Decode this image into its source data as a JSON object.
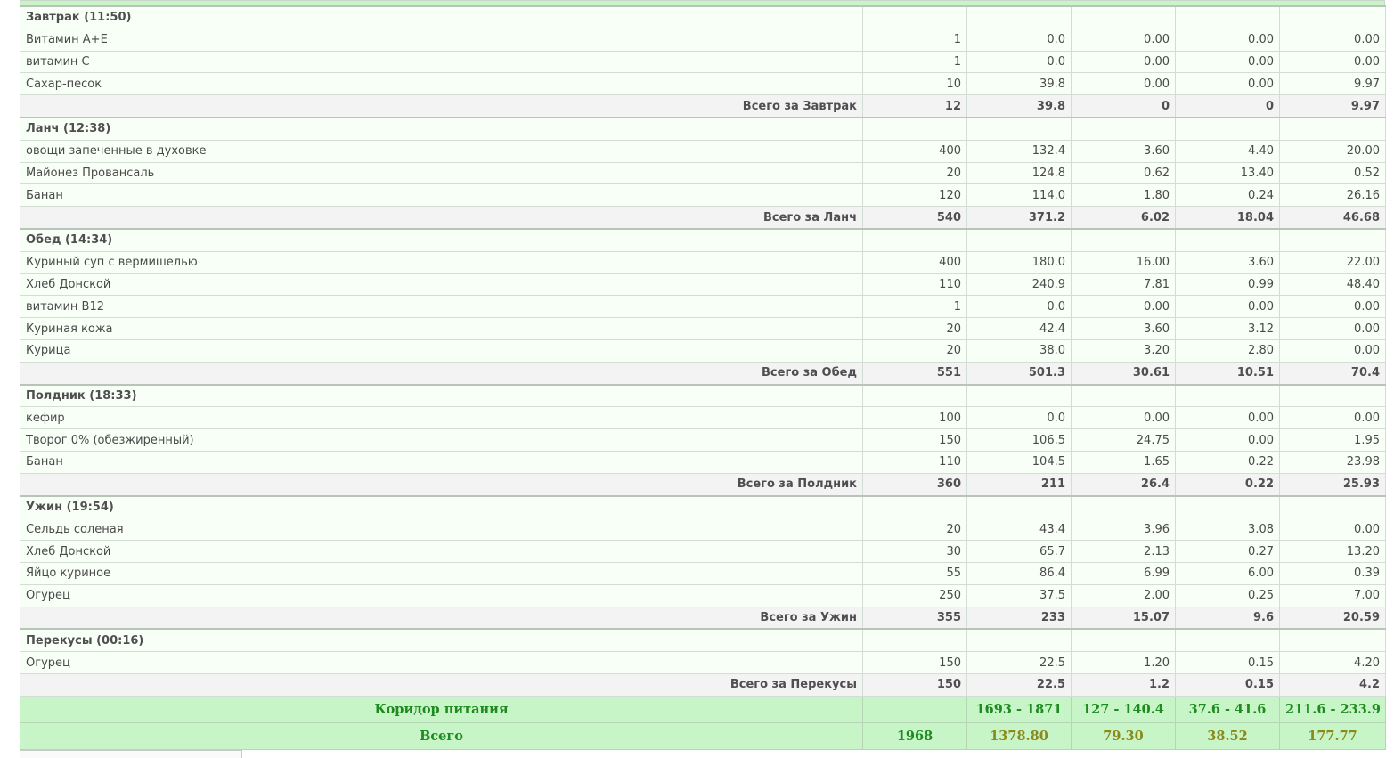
{
  "meals": [
    {
      "title": "Завтрак (11:50)",
      "items": [
        [
          "Витамин А+Е",
          "1",
          "0.0",
          "0.00",
          "0.00",
          "0.00"
        ],
        [
          "витамин С",
          "1",
          "0.0",
          "0.00",
          "0.00",
          "0.00"
        ],
        [
          "Сахар-песок",
          "10",
          "39.8",
          "0.00",
          "0.00",
          "9.97"
        ]
      ],
      "subtotal": [
        "Всего за Завтрак",
        "12",
        "39.8",
        "0",
        "0",
        "9.97"
      ]
    },
    {
      "title": "Ланч (12:38)",
      "items": [
        [
          "овощи запеченные в духовке",
          "400",
          "132.4",
          "3.60",
          "4.40",
          "20.00"
        ],
        [
          "Майонез Провансаль",
          "20",
          "124.8",
          "0.62",
          "13.40",
          "0.52"
        ],
        [
          "Банан",
          "120",
          "114.0",
          "1.80",
          "0.24",
          "26.16"
        ]
      ],
      "subtotal": [
        "Всего за Ланч",
        "540",
        "371.2",
        "6.02",
        "18.04",
        "46.68"
      ]
    },
    {
      "title": "Обед (14:34)",
      "items": [
        [
          "Куриный суп с вермишелью",
          "400",
          "180.0",
          "16.00",
          "3.60",
          "22.00"
        ],
        [
          "Хлеб Донской",
          "110",
          "240.9",
          "7.81",
          "0.99",
          "48.40"
        ],
        [
          "витамин B12",
          "1",
          "0.0",
          "0.00",
          "0.00",
          "0.00"
        ],
        [
          "Куриная кожа",
          "20",
          "42.4",
          "3.60",
          "3.12",
          "0.00"
        ],
        [
          "Курица",
          "20",
          "38.0",
          "3.20",
          "2.80",
          "0.00"
        ]
      ],
      "subtotal": [
        "Всего за Обед",
        "551",
        "501.3",
        "30.61",
        "10.51",
        "70.4"
      ]
    },
    {
      "title": "Полдник (18:33)",
      "items": [
        [
          "кефир",
          "100",
          "0.0",
          "0.00",
          "0.00",
          "0.00"
        ],
        [
          "Творог 0% (обезжиренный)",
          "150",
          "106.5",
          "24.75",
          "0.00",
          "1.95"
        ],
        [
          "Банан",
          "110",
          "104.5",
          "1.65",
          "0.22",
          "23.98"
        ]
      ],
      "subtotal": [
        "Всего за Полдник",
        "360",
        "211",
        "26.4",
        "0.22",
        "25.93"
      ]
    },
    {
      "title": "Ужин (19:54)",
      "items": [
        [
          "Сельдь соленая",
          "20",
          "43.4",
          "3.96",
          "3.08",
          "0.00"
        ],
        [
          "Хлеб Донской",
          "30",
          "65.7",
          "2.13",
          "0.27",
          "13.20"
        ],
        [
          "Яйцо куриное",
          "55",
          "86.4",
          "6.99",
          "6.00",
          "0.39"
        ],
        [
          "Огурец",
          "250",
          "37.5",
          "2.00",
          "0.25",
          "7.00"
        ]
      ],
      "subtotal": [
        "Всего за Ужин",
        "355",
        "233",
        "15.07",
        "9.6",
        "20.59"
      ]
    },
    {
      "title": "Перекусы (00:16)",
      "items": [
        [
          "Огурец",
          "150",
          "22.5",
          "1.20",
          "0.15",
          "4.20"
        ]
      ],
      "subtotal": [
        "Всего за Перекусы",
        "150",
        "22.5",
        "1.2",
        "0.15",
        "4.2"
      ]
    }
  ],
  "corridor": {
    "label": "Коридор питания",
    "weight": "",
    "kcal": "1693 - 1871",
    "protein": "127 - 140.4",
    "fat": "37.6 - 41.6",
    "carbs": "211.6 - 233.9"
  },
  "grand_total": {
    "label": "Всего",
    "weight": "1968",
    "kcal": "1378.80",
    "protein": "79.30",
    "fat": "38.52",
    "carbs": "177.77"
  },
  "colors": {
    "green_bg": "#c8f5c8",
    "green_text": "#1f8a1f",
    "olive_text": "#8a8a1a"
  }
}
